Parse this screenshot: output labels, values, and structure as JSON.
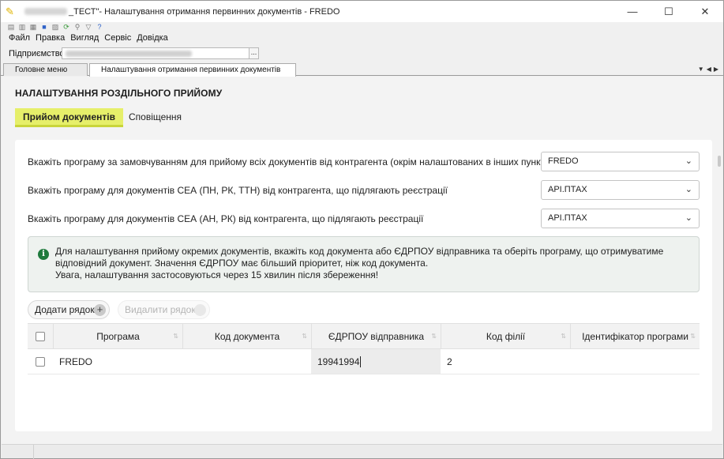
{
  "window": {
    "title_prefix": "_ТЕСТ\"",
    "title": " - Налаштування отримання первинних документів - FREDO",
    "minimize": "—",
    "maximize": "☐",
    "close": "✕"
  },
  "menu": [
    "Файл",
    "Правка",
    "Вигляд",
    "Сервіс",
    "Довідка"
  ],
  "enterprise": {
    "label": "Підприємство",
    "browse": "..."
  },
  "tabs": [
    {
      "label": "Головне меню",
      "active": false
    },
    {
      "label": "Налаштування отримання первинних документів",
      "active": true,
      "close": "✕"
    }
  ],
  "page": {
    "section_title": "НАЛАШТУВАННЯ РОЗДІЛЬНОГО ПРИЙОМУ",
    "subtabs": {
      "receive": "Прийом документів",
      "notifications": "Сповіщення"
    },
    "settings": [
      {
        "label": "Вкажіть програму за замовчуванням для прийому всіх документів від контрагента (окрім налаштованих в інших пунктах)",
        "value": "FREDO"
      },
      {
        "label": "Вкажіть програму для документів СЕА (ПН, РК, ТТН) від контрагента, що підлягають реєстрації",
        "value": "API.ПТАХ"
      },
      {
        "label": "Вкажіть програму для документів СЕА (АН, РК) від контрагента, що підлягають реєстрації",
        "value": "API.ПТАХ"
      }
    ],
    "info": {
      "icon": "i",
      "line1": "Для налаштування прийому окремих документів, вкажіть код документа або ЄДРПОУ відправника та оберіть програму, що отримуватиме відповідний документ. Значення ЄДРПОУ має більший пріоритет, ніж код документа.",
      "line2": "Увага, налаштування застосовуються через 15 хвилин після збереження!"
    },
    "buttons": {
      "add": "Додати рядок",
      "delete": "Видалити рядок",
      "plus": "+"
    },
    "table": {
      "headers": [
        "Програма",
        "Код документа",
        "ЄДРПОУ відправника",
        "Код філії",
        "Ідентифікатор програми"
      ],
      "sort_glyph": "⇅",
      "rows": [
        {
          "program": "FREDO",
          "doc_code": "",
          "edrpou": "19941994",
          "branch": "2",
          "program_id": ""
        }
      ]
    }
  },
  "colors": {
    "accent": "#e6ef6a",
    "info_icon": "#1e7a3c"
  }
}
